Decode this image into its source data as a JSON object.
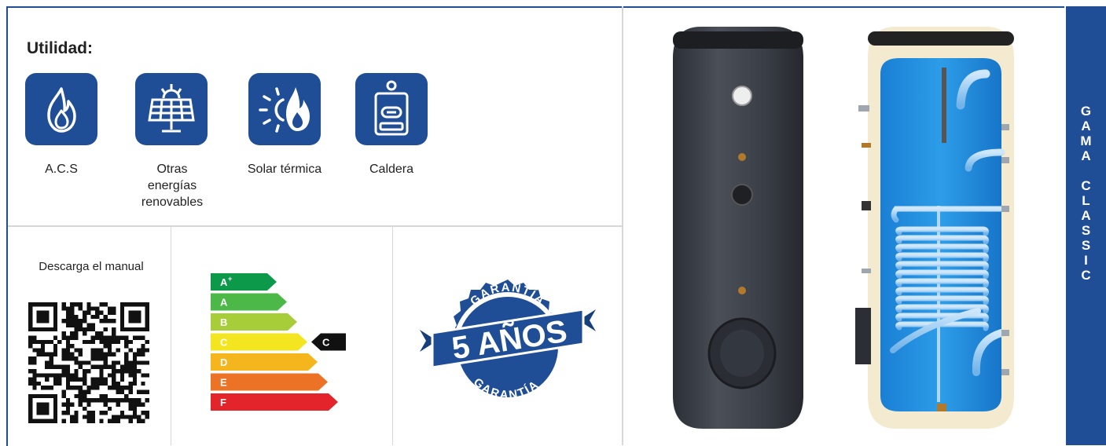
{
  "utility": {
    "title": "Utilidad:",
    "items": [
      {
        "label": "A.C.S",
        "icon": "flame-icon"
      },
      {
        "label": "Otras energías renovables",
        "icon": "solar-panel-icon"
      },
      {
        "label": "Solar térmica",
        "icon": "sun-flame-icon"
      },
      {
        "label": "Caldera",
        "icon": "boiler-icon"
      }
    ]
  },
  "download": {
    "text": "Descarga el manual"
  },
  "energy_label": {
    "classes": [
      {
        "label": "A",
        "sup": "+",
        "color": "#0c9a4a"
      },
      {
        "label": "A",
        "sup": "",
        "color": "#4bb848"
      },
      {
        "label": "B",
        "sup": "",
        "color": "#a7cd39"
      },
      {
        "label": "C",
        "sup": "",
        "color": "#f3e620"
      },
      {
        "label": "D",
        "sup": "",
        "color": "#f4b51d"
      },
      {
        "label": "E",
        "sup": "",
        "color": "#ec7325"
      },
      {
        "label": "F",
        "sup": "",
        "color": "#e3242b"
      }
    ],
    "rating": "C"
  },
  "warranty": {
    "top_text": "GARANTÍA",
    "main": "5 AÑOS",
    "bottom_text": "GARANTÍA"
  },
  "side_band": {
    "letters": [
      "G",
      "A",
      "M",
      "A",
      "",
      "C",
      "L",
      "A",
      "S",
      "S",
      "I",
      "C"
    ]
  },
  "colors": {
    "brand_blue": "#1f4e96"
  }
}
